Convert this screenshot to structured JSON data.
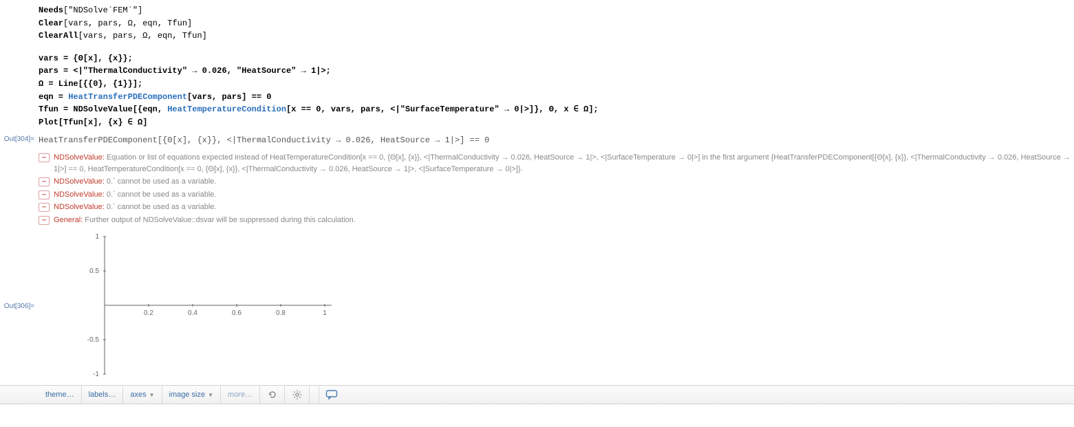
{
  "input": {
    "lines": {
      "l1a": "Needs",
      "l1b": "[\"NDSolve`FEM`\"]",
      "l2a": "Clear",
      "l2b": "[vars, pars, Ω, eqn, Tfun]",
      "l3a": "ClearAll",
      "l3b": "[vars, pars, Ω, eqn, Tfun]",
      "l4": "vars = {Θ[x], {x}};",
      "l5": "pars = <|\"ThermalConductivity\" → 0.026, \"HeatSource\" → 1|>;",
      "l6": "Ω = Line[{{0}, {1}}];",
      "l7a": "eqn = ",
      "l7b": "HeatTransferPDEComponent",
      "l7c": "[vars, pars] == 0",
      "l8a": "Tfun = NDSolveValue[{eqn, ",
      "l8b": "HeatTemperatureCondition",
      "l8c": "[x == 0, vars, pars, <|\"SurfaceTemperature\" → 0|>]}, Θ, x ∈ Ω];",
      "l9": "Plot[Tfun[x], {x} ∈ Ω]"
    }
  },
  "out304": {
    "label": "Out[304]=",
    "expr": "HeatTransferPDEComponent[{Θ[x], {x}}, <|ThermalConductivity → 0.026, HeatSource → 1|>] == 0"
  },
  "messages": {
    "m1_tag": "NDSolveValue:",
    "m1_text": " Equation or list of equations expected instead of HeatTemperatureCondition[x == 0, {Θ[x], {x}}, <|ThermalConductivity → 0.026, HeatSource → 1|>, <|SurfaceTemperature → 0|>] in the first argument {HeatTransferPDEComponent[{Θ[x], {x}}, <|ThermalConductivity → 0.026, HeatSource → 1|>] == 0, HeatTemperatureCondition[x == 0, {Θ[x], {x}}, <|ThermalConductivity → 0.026, HeatSource → 1|>, <|SurfaceTemperature → 0|>]}.",
    "m2_tag": "NDSolveValue:",
    "m2_text": " 0.` cannot be used as a variable.",
    "m3_tag": "NDSolveValue:",
    "m3_text": " 0.` cannot be used as a variable.",
    "m4_tag": "NDSolveValue:",
    "m4_text": " 0.` cannot be used as a variable.",
    "m5_tag": "General:",
    "m5_text": " Further output of NDSolveValue::dsvar will be suppressed during this calculation."
  },
  "out306": {
    "label": "Out[306]="
  },
  "chart_data": {
    "type": "line",
    "title": "",
    "xlabel": "",
    "ylabel": "",
    "xlim": [
      0,
      1.0
    ],
    "ylim": [
      -1.0,
      1.0
    ],
    "xticks": [
      0.2,
      0.4,
      0.6,
      0.8,
      1.0
    ],
    "yticks": [
      -1.0,
      -0.5,
      0.5,
      1.0
    ],
    "series": []
  },
  "toolbar": {
    "theme": "theme…",
    "labels": "labels…",
    "axes": "axes",
    "imagesize": "image size",
    "more": "more…"
  }
}
